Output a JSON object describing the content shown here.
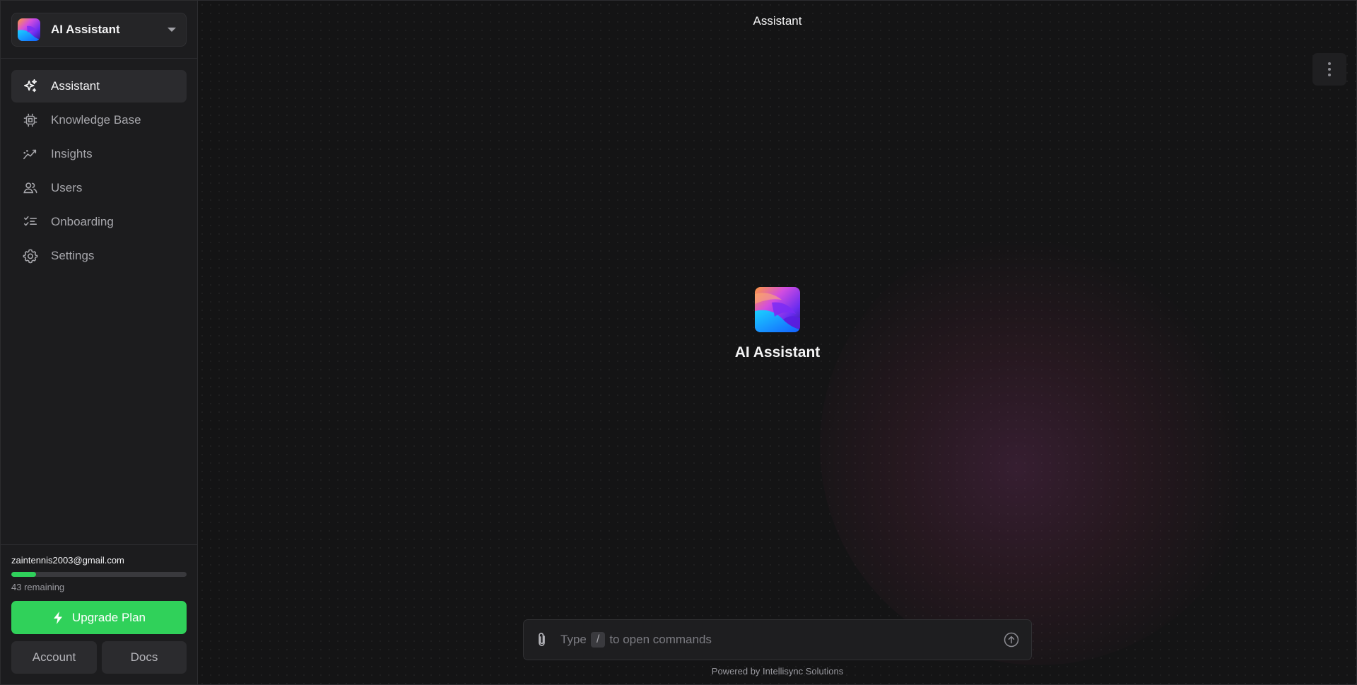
{
  "workspace": {
    "name": "AI Assistant"
  },
  "sidebar": {
    "items": [
      {
        "label": "Assistant",
        "icon": "sparkles-icon",
        "active": true
      },
      {
        "label": "Knowledge Base",
        "icon": "chip-icon",
        "active": false
      },
      {
        "label": "Insights",
        "icon": "trend-chart-icon",
        "active": false
      },
      {
        "label": "Users",
        "icon": "users-icon",
        "active": false
      },
      {
        "label": "Onboarding",
        "icon": "checklist-icon",
        "active": false
      },
      {
        "label": "Settings",
        "icon": "gear-icon",
        "active": false
      }
    ]
  },
  "account": {
    "email": "zaintennis2003@gmail.com",
    "usage_fraction": 0.14,
    "remaining": "43 remaining",
    "upgrade_label": "Upgrade Plan",
    "account_label": "Account",
    "docs_label": "Docs"
  },
  "main": {
    "title": "Assistant",
    "assistant_name": "AI Assistant",
    "menu_icon": "more-vertical-icon"
  },
  "composer": {
    "placeholder_prefix": "Type",
    "placeholder_key": "/",
    "placeholder_suffix": "to open commands",
    "attach_icon": "paperclip-icon",
    "send_icon": "send-arrow-icon"
  },
  "footer": {
    "powered_by": "Powered by Intellisync Solutions"
  },
  "colors": {
    "accent": "#30d15a",
    "background": "#141415",
    "sidebar": "#1c1c1e"
  }
}
